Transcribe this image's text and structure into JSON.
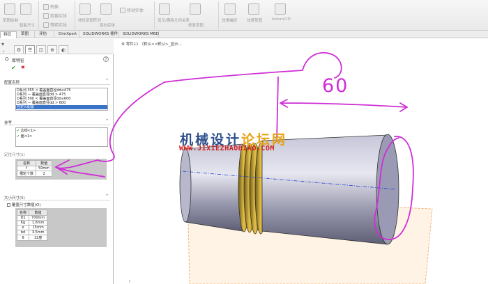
{
  "ribbon": {
    "buttons": [
      "转换",
      "剪裁实体",
      "等距实体",
      "线性草图阵列",
      "镜向实体",
      "移动实体",
      "显示/删除几何关系",
      "修复草图",
      "快速捕捉",
      "快速草图",
      "Instant2D"
    ],
    "group_labels": [
      "草图绘制",
      "智能尺寸",
      "实体",
      "阵列",
      "几何关系"
    ]
  },
  "tabs": [
    "特征",
    "草图",
    "评估",
    "DimXpert",
    "SOLIDWORKS 插件",
    "SOLIDWORKS MBD"
  ],
  "panel": {
    "title": "库特征",
    "help_icon": "?",
    "ok_icon": "✔",
    "cancel_icon": "✖",
    "sizes_header": "配置名称",
    "sizes_list": [
      "D系列 355 < 覆盖面直径dd≤475",
      "D系列 — 覆盖面直径dd > 475",
      "D系列 500 < 覆盖面直径dd≤600",
      "D系列 — 覆盖面直径dd > 600",
      "自定义配置"
    ],
    "refs_header": "参考",
    "refs": [
      "边线<1>",
      "面<1>"
    ],
    "location_header": "定位尺寸(1)",
    "location_table": {
      "headers": [
        "名称",
        "数值"
      ],
      "rows": [
        [
          "f",
          "50mm"
        ],
        [
          "槽轮个数",
          "2"
        ]
      ]
    },
    "size_header": "大小尺寸(5)",
    "size_option": "覆盖尺寸数值(O)",
    "size_table": {
      "headers": [
        "名称",
        "数值"
      ],
      "rows": [
        [
          "D1",
          "700mm"
        ],
        [
          "Kg",
          "1.6mm"
        ],
        [
          "e",
          "15mm"
        ],
        [
          "bd",
          "3.5mm"
        ],
        [
          "θ",
          "32度"
        ]
      ]
    }
  },
  "viewport": {
    "breadcrumb": "零件11 （默认<<默认>_显示...",
    "sketch_dimension": "60",
    "watermark_cn": "机械设计",
    "watermark_cn_tail": "论坛网",
    "watermark_url": "WWW.JIXIEZHAOBIAO.COM"
  }
}
